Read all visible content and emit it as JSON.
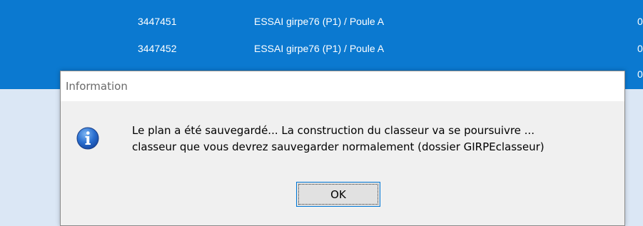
{
  "grid": {
    "rows": [
      {
        "id": "3447451",
        "name": "ESSAI girpe76 (P1) / Poule A",
        "extra": "0"
      },
      {
        "id": "3447452",
        "name": "ESSAI girpe76 (P1) / Poule A",
        "extra": "0"
      },
      {
        "id": "",
        "name": "",
        "extra": "0"
      }
    ]
  },
  "dialog": {
    "title": "Information",
    "icon": "info-icon",
    "message_line1": "Le plan a été sauvegardé... La construction du classeur va se poursuivre ...",
    "message_line2": "classeur que vous devrez sauvegarder normalement (dossier GIRPEclasseur)",
    "ok_label": "OK"
  },
  "colors": {
    "selection": "#0b79d0",
    "grid_background": "#dbe7f5",
    "dialog_background": "#f0f0f0",
    "accent": "#0078d7"
  }
}
